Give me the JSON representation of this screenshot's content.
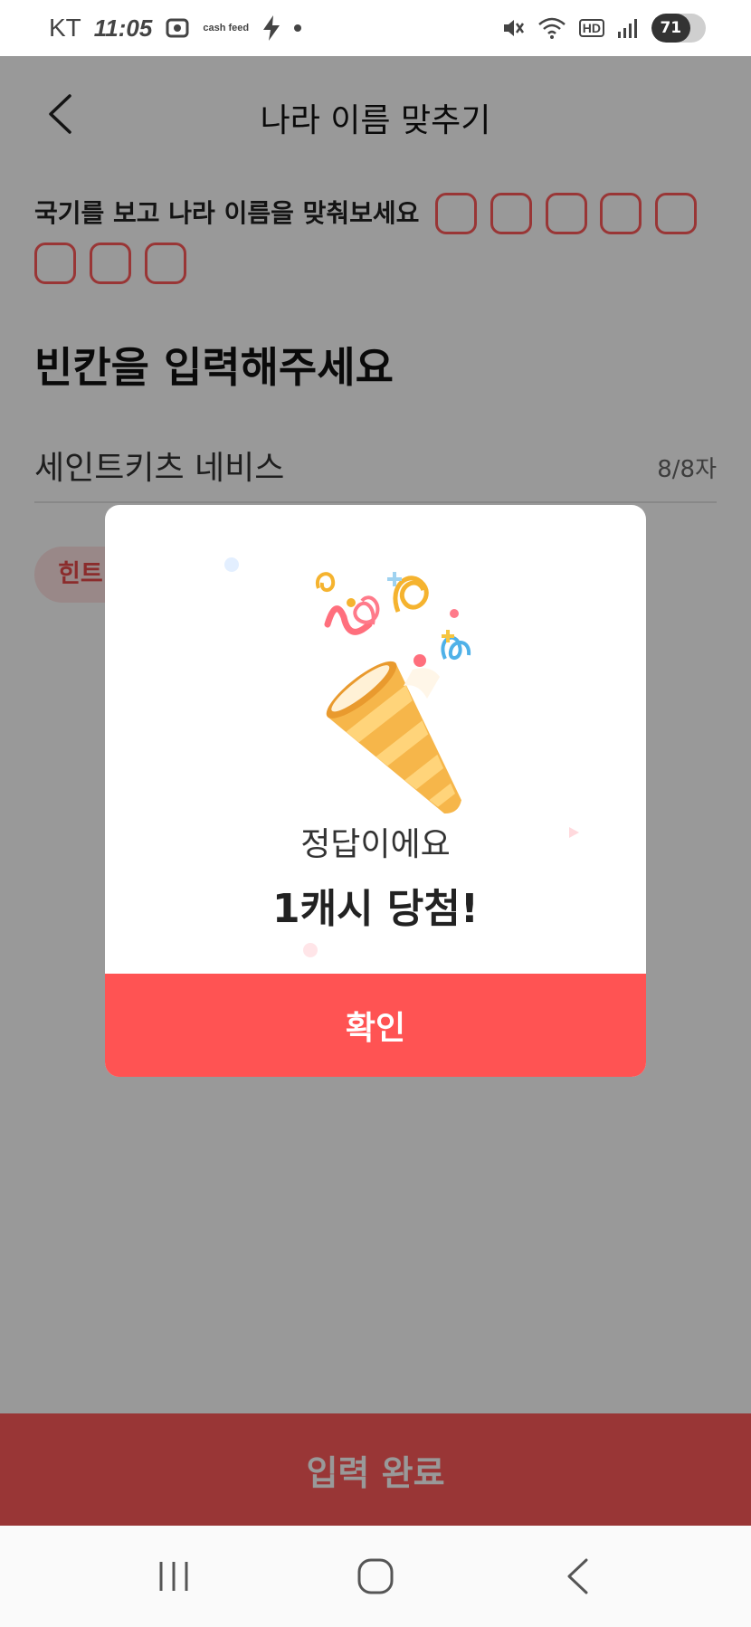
{
  "status_bar": {
    "carrier": "KT",
    "time": "11:05",
    "cashfeed_label": "cash feed",
    "battery_label": "71",
    "hd_label": "HD",
    "icons": [
      "screenshot-icon",
      "cashfeed-icon",
      "charging-bolt-icon",
      "notification-dot",
      "mute-icon",
      "wifi-icon",
      "hd-voice-icon",
      "signal-icon",
      "battery-icon"
    ]
  },
  "header": {
    "title": "나라 이름 맞추기",
    "back_icon": "back-chevron-icon"
  },
  "quiz": {
    "instruction": "국기를 보고 나라 이름을 맞춰보세요",
    "blank_slots": 8,
    "section_heading": "빈칸을 입력해주세요",
    "answer_value": "세인트키츠 네비스",
    "char_count": "8/8자",
    "hint_label": "힌트"
  },
  "submit": {
    "label": "입력 완료"
  },
  "modal": {
    "illustration": "party-popper-icon",
    "message": "정답이에요",
    "reward": "1캐시 당첨!",
    "confirm_label": "확인"
  },
  "navbar": {
    "items": [
      "recent-apps-icon",
      "home-icon",
      "back-icon"
    ]
  },
  "colors": {
    "accent": "#ff5353",
    "overlay": "rgba(0,0,0,0.40)",
    "hint_bg": "#ffe3e3"
  }
}
